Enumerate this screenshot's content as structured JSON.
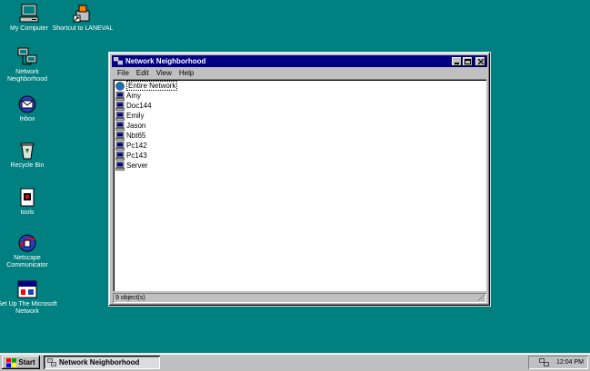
{
  "desktop_icons": [
    {
      "label": "My Computer",
      "icon": "my-computer-icon"
    },
    {
      "label": "Shortcut to LANEVAL",
      "icon": "shortcut-laneval-icon"
    },
    {
      "label": "Network Neighborhood",
      "icon": "network-neighborhood-icon"
    },
    {
      "label": "Inbox",
      "icon": "inbox-icon"
    },
    {
      "label": "Recycle Bin",
      "icon": "recycle-bin-icon"
    },
    {
      "label": "tools",
      "icon": "tools-icon"
    },
    {
      "label": "Netscape Communicator",
      "icon": "netscape-icon"
    },
    {
      "label": "Set Up The Microsoft Network",
      "icon": "msn-icon"
    }
  ],
  "window": {
    "title": "Network Neighborhood",
    "menu": [
      "File",
      "Edit",
      "View",
      "Help"
    ],
    "items": [
      "Entire Network",
      "Amy",
      "Doc144",
      "Emily",
      "Jason",
      "Nbt65",
      "Pc142",
      "Pc143",
      "Server"
    ],
    "selected_item": "Entire Network",
    "status": "9 object(s)"
  },
  "taskbar": {
    "start_label": "Start",
    "task_label": "Network Neighborhood",
    "clock": "12:04 PM"
  },
  "colors": {
    "desktop": "#008080",
    "titlebar": "#000080",
    "chrome": "#c0c0c0"
  }
}
